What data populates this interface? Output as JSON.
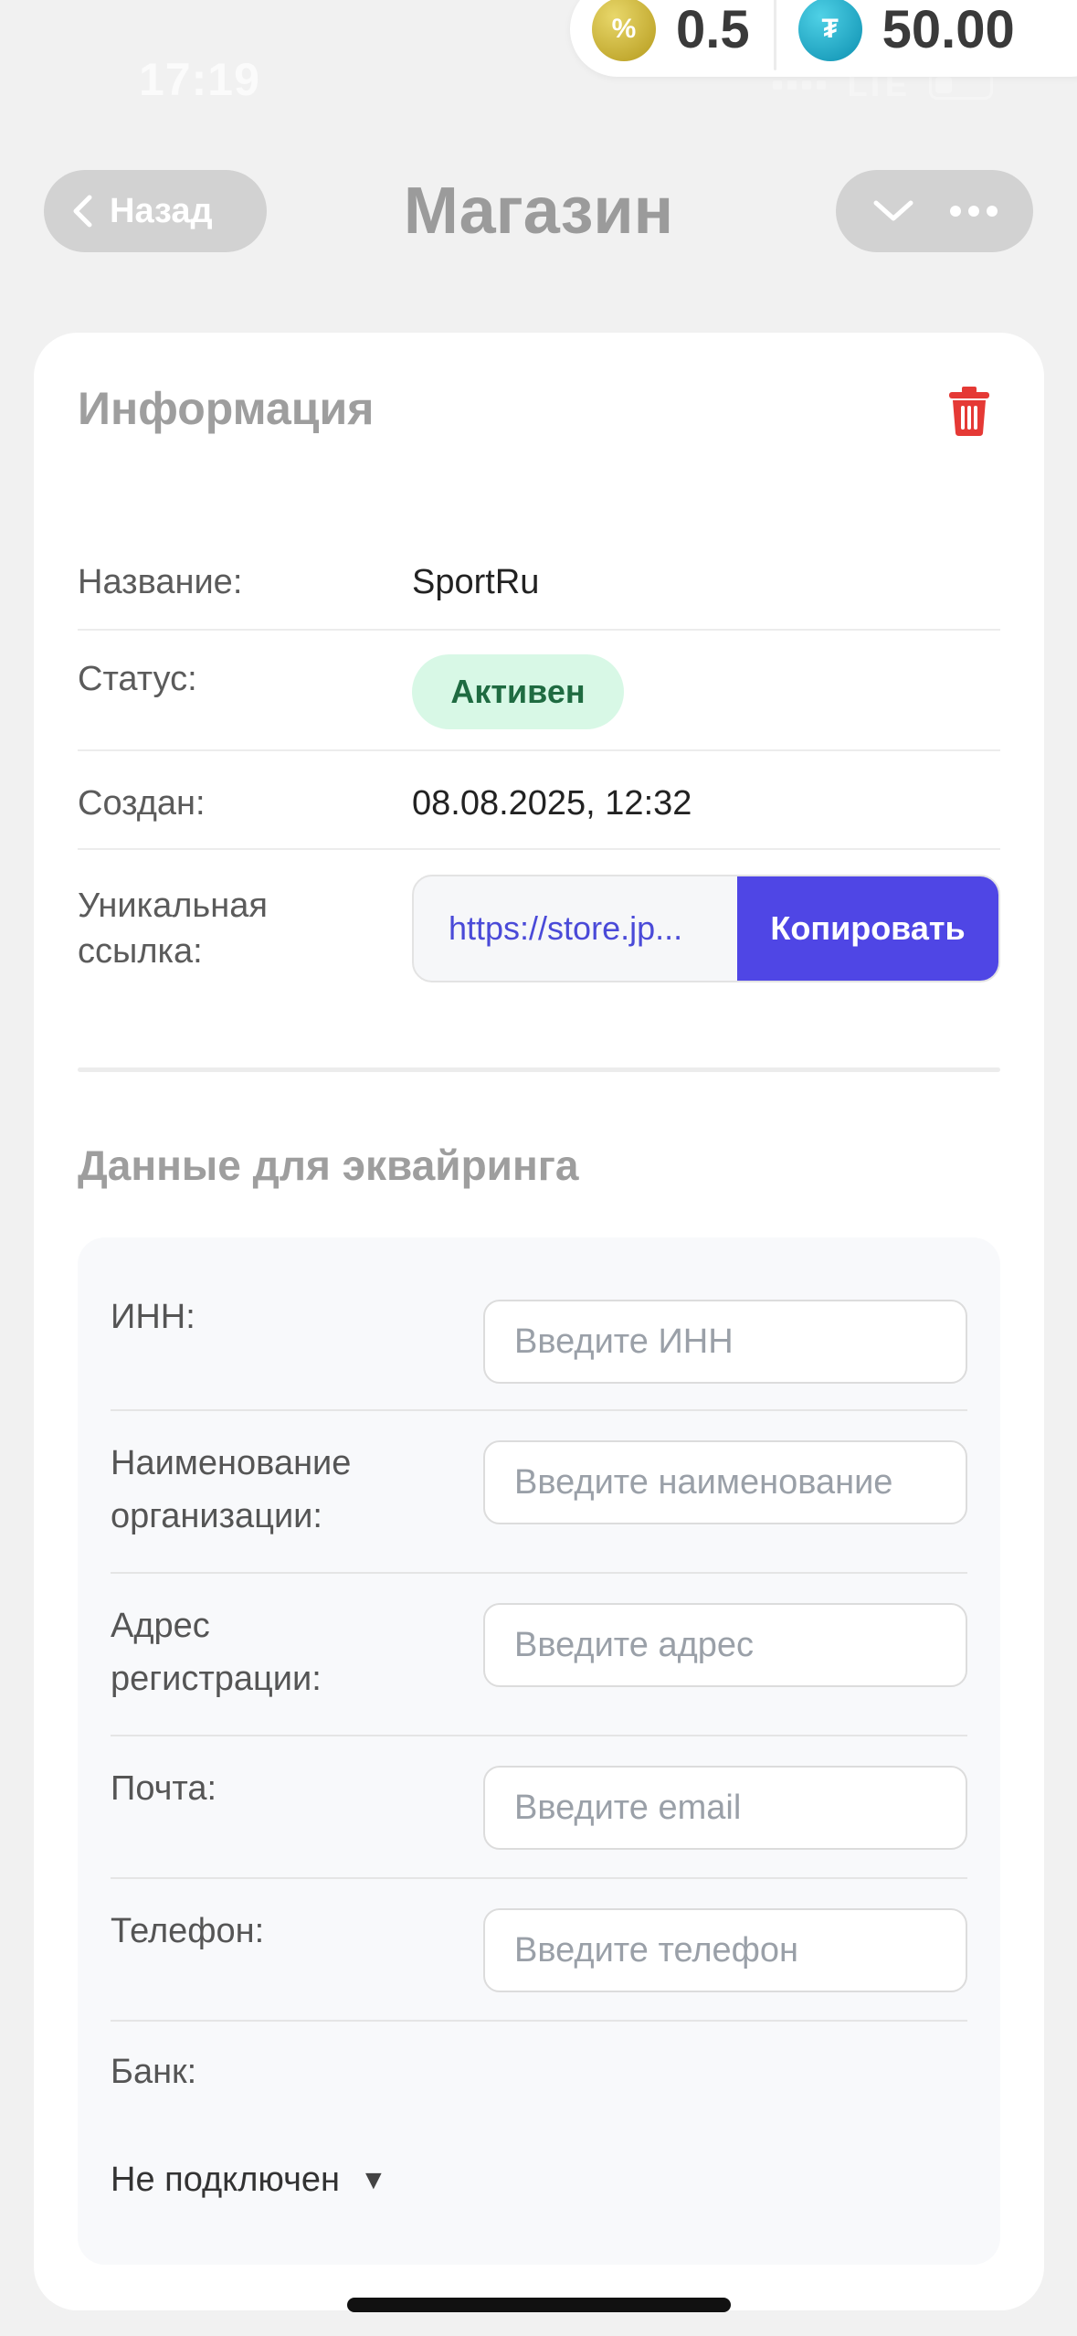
{
  "status_bar": {
    "time": "17:19",
    "network": "LTE"
  },
  "balances": [
    {
      "icon": "percent-coin-icon",
      "symbol": "%",
      "value": "0.5",
      "color": "#c9b43a"
    },
    {
      "icon": "tether-coin-icon",
      "symbol": "₮",
      "value": "50.00",
      "color": "#1ba6c9"
    }
  ],
  "nav": {
    "back_label": "Назад",
    "title": "Магазин"
  },
  "info": {
    "title": "Информация",
    "name_label": "Название:",
    "name_value": "SportRu",
    "status_label": "Статус:",
    "status_value": "Активен",
    "status_color": "#d8f8e6",
    "created_label": "Создан:",
    "created_value": "08.08.2025, 12:32",
    "link_label_line1": "Уникальная",
    "link_label_line2": "ссылка:",
    "link_value": "https://store.jp...",
    "copy_label": "Копировать",
    "accent": "#4f46e5"
  },
  "acquiring": {
    "title": "Данные для эквайринга",
    "inn_label": "ИНН:",
    "inn_placeholder": "Введите ИНН",
    "org_label_line1": "Наименование",
    "org_label_line2": "организации:",
    "org_placeholder": "Введите наименование",
    "addr_label_line1": "Адрес",
    "addr_label_line2": "регистрации:",
    "addr_placeholder": "Введите адрес",
    "email_label": "Почта:",
    "email_placeholder": "Введите email",
    "phone_label": "Телефон:",
    "phone_placeholder": "Введите телефон",
    "bank_label": "Банк:",
    "bank_value": "Не подключен",
    "bank_arrow": "▼"
  }
}
